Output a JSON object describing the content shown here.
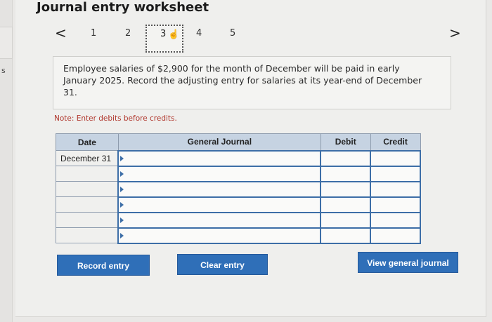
{
  "title": "Journal entry worksheet",
  "left_strip": {
    "letter": "s"
  },
  "pager": {
    "prev_symbol": "<",
    "next_symbol": ">",
    "pages": [
      "1",
      "2",
      "3",
      "4",
      "5"
    ],
    "current_page": "3"
  },
  "prompt": "Employee salaries of $2,900 for the month of December will be paid in early January 2025. Record the adjusting entry for salaries at its year-end of December 31.",
  "note": "Note: Enter debits before credits.",
  "table": {
    "headers": {
      "date": "Date",
      "journal": "General Journal",
      "debit": "Debit",
      "credit": "Credit"
    },
    "rows": [
      {
        "date": "December 31",
        "account": "",
        "debit": "",
        "credit": ""
      },
      {
        "date": "",
        "account": "",
        "debit": "",
        "credit": ""
      },
      {
        "date": "",
        "account": "",
        "debit": "",
        "credit": ""
      },
      {
        "date": "",
        "account": "",
        "debit": "",
        "credit": ""
      },
      {
        "date": "",
        "account": "",
        "debit": "",
        "credit": ""
      },
      {
        "date": "",
        "account": "",
        "debit": "",
        "credit": ""
      }
    ]
  },
  "buttons": {
    "record": "Record entry",
    "clear": "Clear entry",
    "view": "View general journal"
  },
  "colors": {
    "button_blue": "#2f6fb8",
    "header_blue": "#c6d3e2",
    "note_red": "#b0362c"
  }
}
